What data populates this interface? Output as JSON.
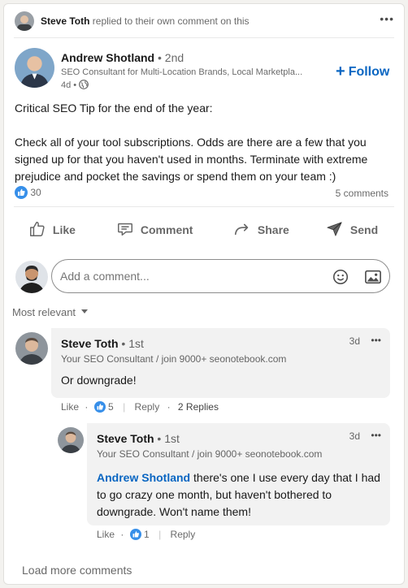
{
  "header": {
    "actor_name": "Steve Toth",
    "actor_action": "replied to their own comment on this",
    "more_label": "•••"
  },
  "post": {
    "author_name": "Andrew Shotland",
    "degree": "• 2nd",
    "headline": "SEO Consultant for Multi-Location Brands, Local Marketpla...",
    "time": "4d •",
    "follow_label": "Follow",
    "body_line1": "Critical SEO Tip for the end of the year:",
    "body_line2": "Check all of your tool subscriptions. Odds are there are a few that you",
    "body_line3": "signed up for that you haven't used in months. Terminate with extreme",
    "body_line4": "prejudice and pocket the savings or spend them on your team :)",
    "reactions_count": "30",
    "comments_count": "5 comments"
  },
  "actions": {
    "like": "Like",
    "comment": "Comment",
    "share": "Share",
    "send": "Send"
  },
  "composer": {
    "placeholder": "Add a comment..."
  },
  "sort": {
    "label": "Most relevant"
  },
  "comments": [
    {
      "author": "Steve Toth",
      "degree": "• 1st",
      "headline": "Your SEO Consultant / join 9000+ seonotebook.com",
      "time": "3d",
      "more": "•••",
      "text": "Or downgrade!",
      "like_label": "Like",
      "reaction_count": "5",
      "reply_label": "Reply",
      "replies_label": "2 Replies"
    }
  ],
  "reply": {
    "author": "Steve Toth",
    "degree": "• 1st",
    "headline": "Your SEO Consultant / join 9000+ seonotebook.com",
    "time": "3d",
    "more": "•••",
    "mention": "Andrew Shotland",
    "text_line1": " there's one I use every day that I had",
    "text_line2": "to go crazy one month, but haven't bothered to",
    "text_line3": "downgrade. Won't name them!",
    "like_label": "Like",
    "reaction_count": "1",
    "reply_label": "Reply"
  },
  "footer": {
    "load_more": "Load more comments"
  },
  "colors": {
    "brand_blue": "#0a66c2",
    "like_blue": "#378fe9",
    "bubble_gray": "#f2f2f2"
  }
}
